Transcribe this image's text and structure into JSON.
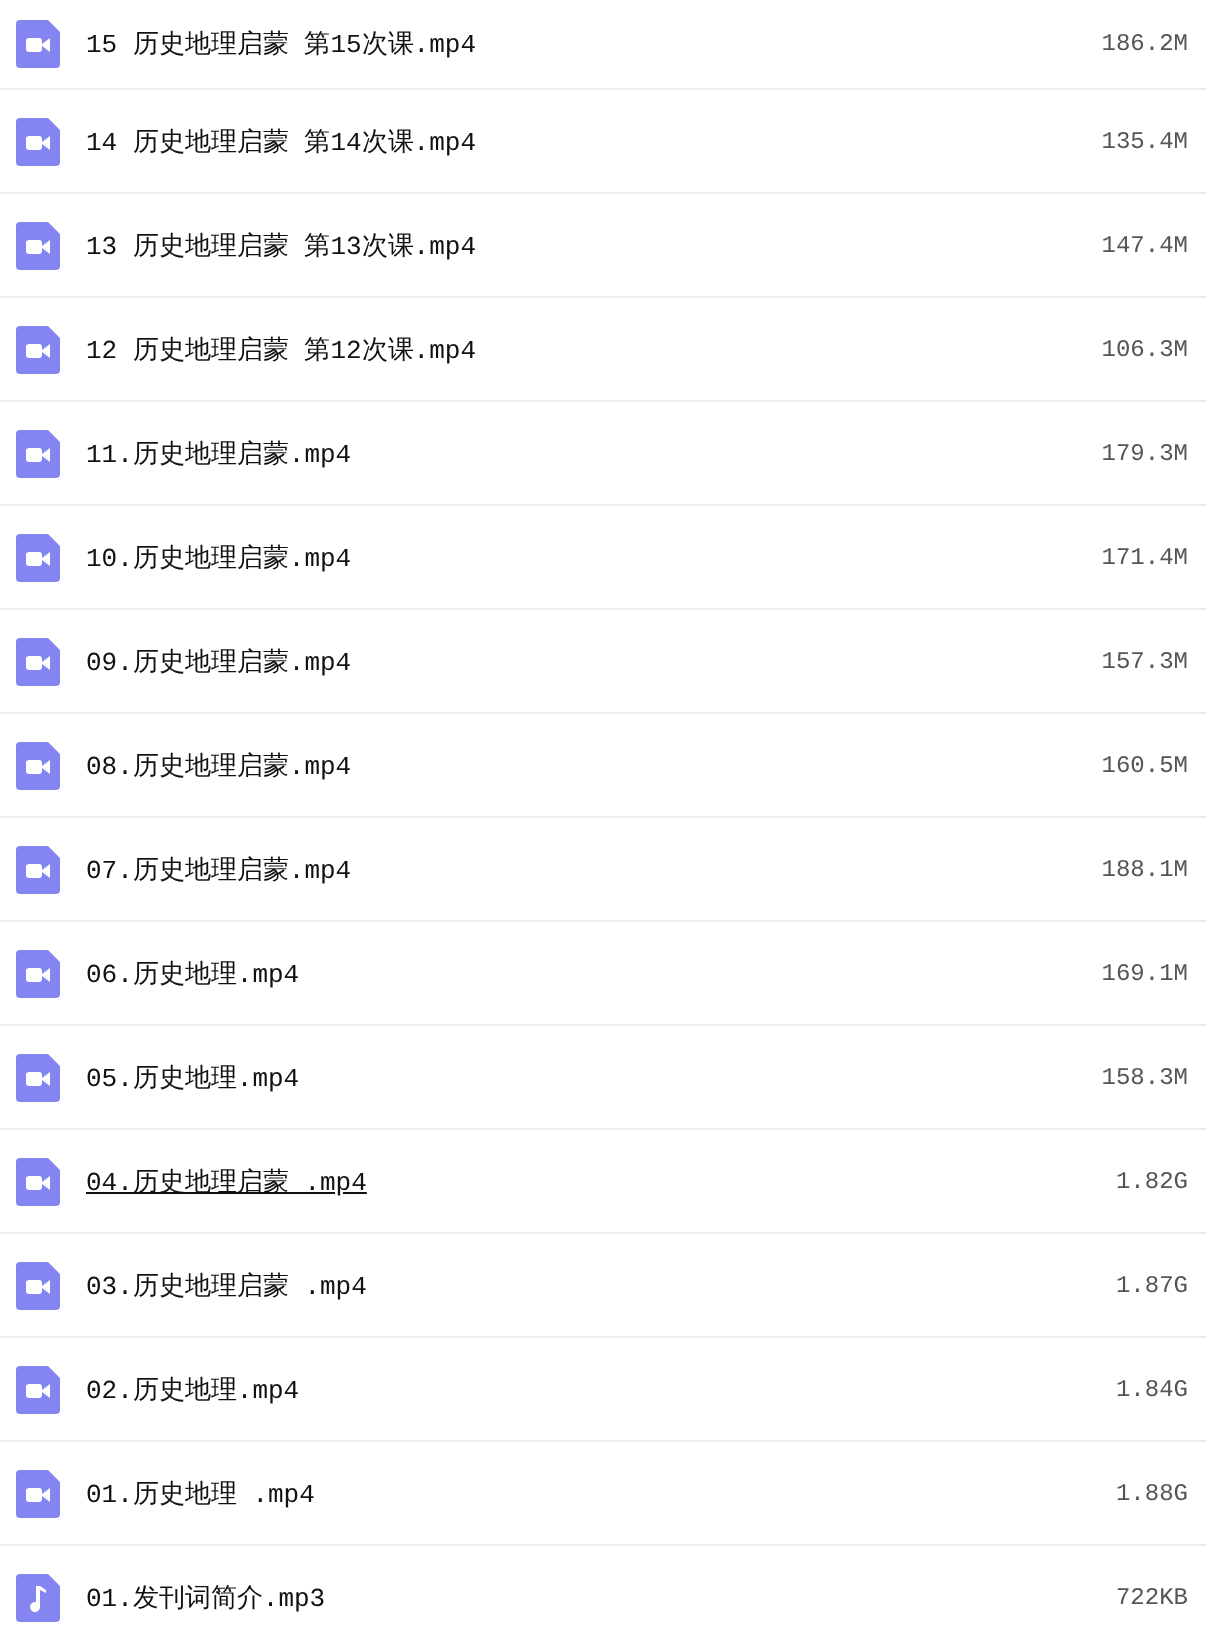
{
  "files": [
    {
      "kind": "video",
      "name": "15 历史地理启蒙 第15次课.mp4",
      "size": "186.2M",
      "hovered": false
    },
    {
      "kind": "video",
      "name": "14 历史地理启蒙 第14次课.mp4",
      "size": "135.4M",
      "hovered": false
    },
    {
      "kind": "video",
      "name": "13 历史地理启蒙 第13次课.mp4",
      "size": "147.4M",
      "hovered": false
    },
    {
      "kind": "video",
      "name": "12 历史地理启蒙 第12次课.mp4",
      "size": "106.3M",
      "hovered": false
    },
    {
      "kind": "video",
      "name": "11.历史地理启蒙.mp4",
      "size": "179.3M",
      "hovered": false
    },
    {
      "kind": "video",
      "name": "10.历史地理启蒙.mp4",
      "size": "171.4M",
      "hovered": false
    },
    {
      "kind": "video",
      "name": "09.历史地理启蒙.mp4",
      "size": "157.3M",
      "hovered": false
    },
    {
      "kind": "video",
      "name": "08.历史地理启蒙.mp4",
      "size": "160.5M",
      "hovered": false
    },
    {
      "kind": "video",
      "name": "07.历史地理启蒙.mp4",
      "size": "188.1M",
      "hovered": false
    },
    {
      "kind": "video",
      "name": "06.历史地理.mp4",
      "size": "169.1M",
      "hovered": false
    },
    {
      "kind": "video",
      "name": "05.历史地理.mp4",
      "size": "158.3M",
      "hovered": false
    },
    {
      "kind": "video",
      "name": "04.历史地理启蒙 .mp4",
      "size": "1.82G",
      "hovered": true
    },
    {
      "kind": "video",
      "name": "03.历史地理启蒙 .mp4",
      "size": "1.87G",
      "hovered": false
    },
    {
      "kind": "video",
      "name": "02.历史地理.mp4",
      "size": "1.84G",
      "hovered": false
    },
    {
      "kind": "video",
      "name": "01.历史地理 .mp4",
      "size": "1.88G",
      "hovered": false
    },
    {
      "kind": "audio",
      "name": "01.发刊词简介.mp3",
      "size": "722KB",
      "hovered": false
    }
  ]
}
